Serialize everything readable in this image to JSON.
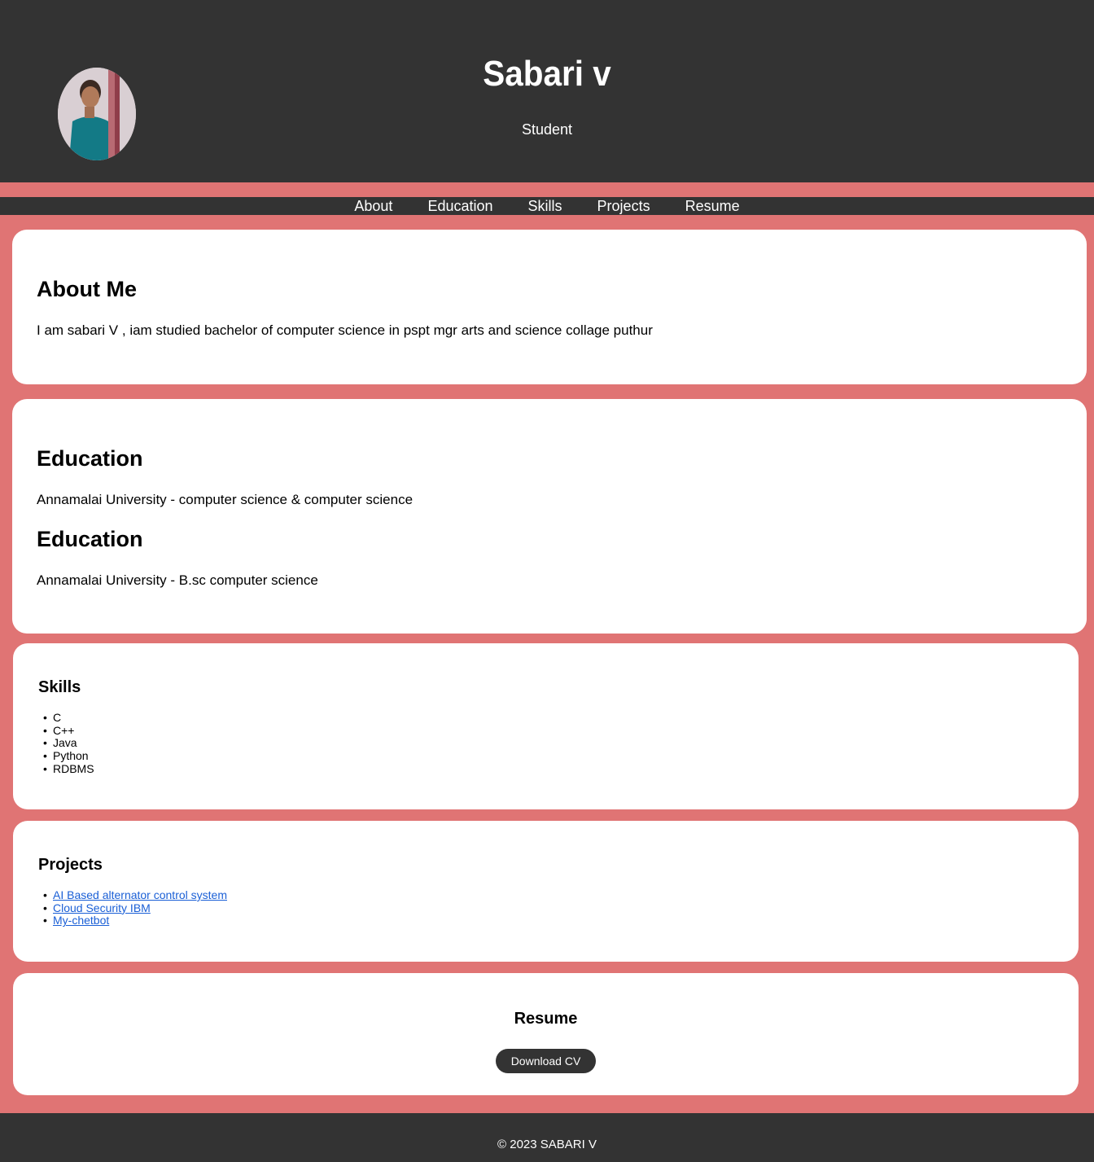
{
  "header": {
    "name": "Sabari v",
    "role": "Student"
  },
  "nav": {
    "items": [
      {
        "label": "About"
      },
      {
        "label": "Education"
      },
      {
        "label": "Skills"
      },
      {
        "label": "Projects"
      },
      {
        "label": "Resume"
      }
    ]
  },
  "about": {
    "title": "About Me",
    "text": "I am sabari V , iam studied bachelor of computer science in pspt mgr arts and science collage puthur"
  },
  "education": {
    "entries": [
      {
        "title": "Education",
        "text": "Annamalai University - computer science & computer science"
      },
      {
        "title": "Education",
        "text": "Annamalai University - B.sc computer science"
      }
    ]
  },
  "skills": {
    "title": "Skills",
    "items": [
      "C",
      "C++",
      "Java",
      "Python",
      "RDBMS"
    ]
  },
  "projects": {
    "title": "Projects",
    "items": [
      "AI Based alternator control system",
      "Cloud Security IBM",
      "My-chetbot"
    ]
  },
  "resume": {
    "title": "Resume",
    "button_label": "Download CV"
  },
  "footer": {
    "text": "© 2023 SABARI V"
  },
  "colors": {
    "page_background": "#e07474",
    "header_background": "#333333",
    "card_background": "#ffffff",
    "link": "#1a5fd6"
  }
}
